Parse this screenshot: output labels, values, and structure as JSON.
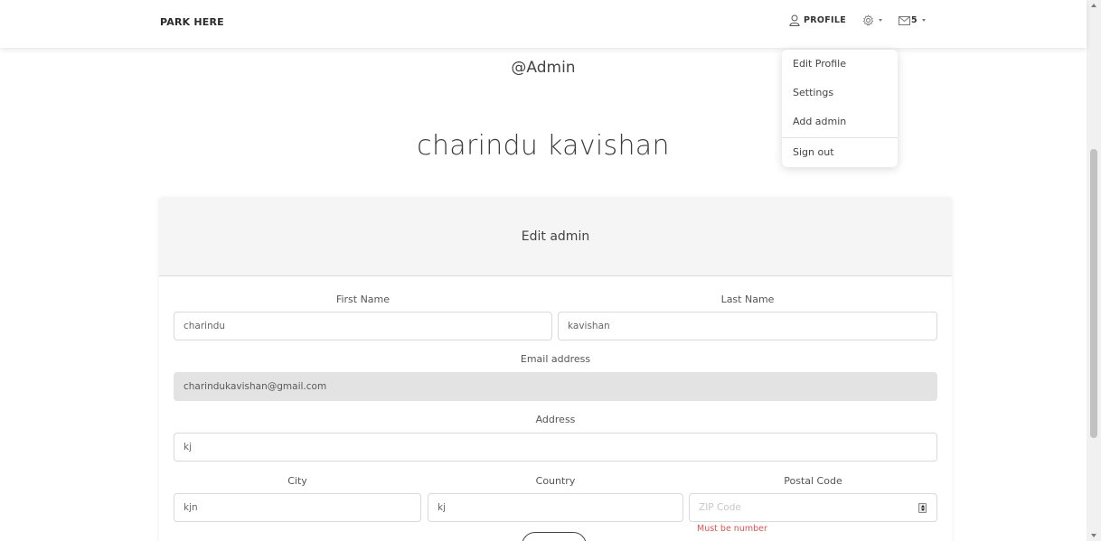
{
  "navbar": {
    "brand": "PARK HERE",
    "profile_label": "PROFILE",
    "settings_icon": "gear-icon",
    "mail_icon": "envelope-icon",
    "mail_count": "5"
  },
  "dropdown": {
    "items": [
      "Edit Profile",
      "Settings",
      "Add admin"
    ],
    "sign_out": "Sign out"
  },
  "profile": {
    "username": "@Admin",
    "fullname": "charindu kavishan"
  },
  "form": {
    "title": "Edit admin",
    "first_name_label": "First Name",
    "first_name_value": "charindu",
    "last_name_label": "Last Name",
    "last_name_value": "kavishan",
    "email_label": "Email address",
    "email_value": "charindukavishan@gmail.com",
    "address_label": "Address",
    "address_value": "kj",
    "city_label": "City",
    "city_value": "kjn",
    "country_label": "Country",
    "country_value": "kj",
    "postal_label": "Postal Code",
    "postal_placeholder": "ZIP Code",
    "postal_error": "Must be number"
  },
  "colors": {
    "error": "#e55353",
    "header_bg": "#f5f5f5",
    "disabled_bg": "#e3e3e3"
  }
}
